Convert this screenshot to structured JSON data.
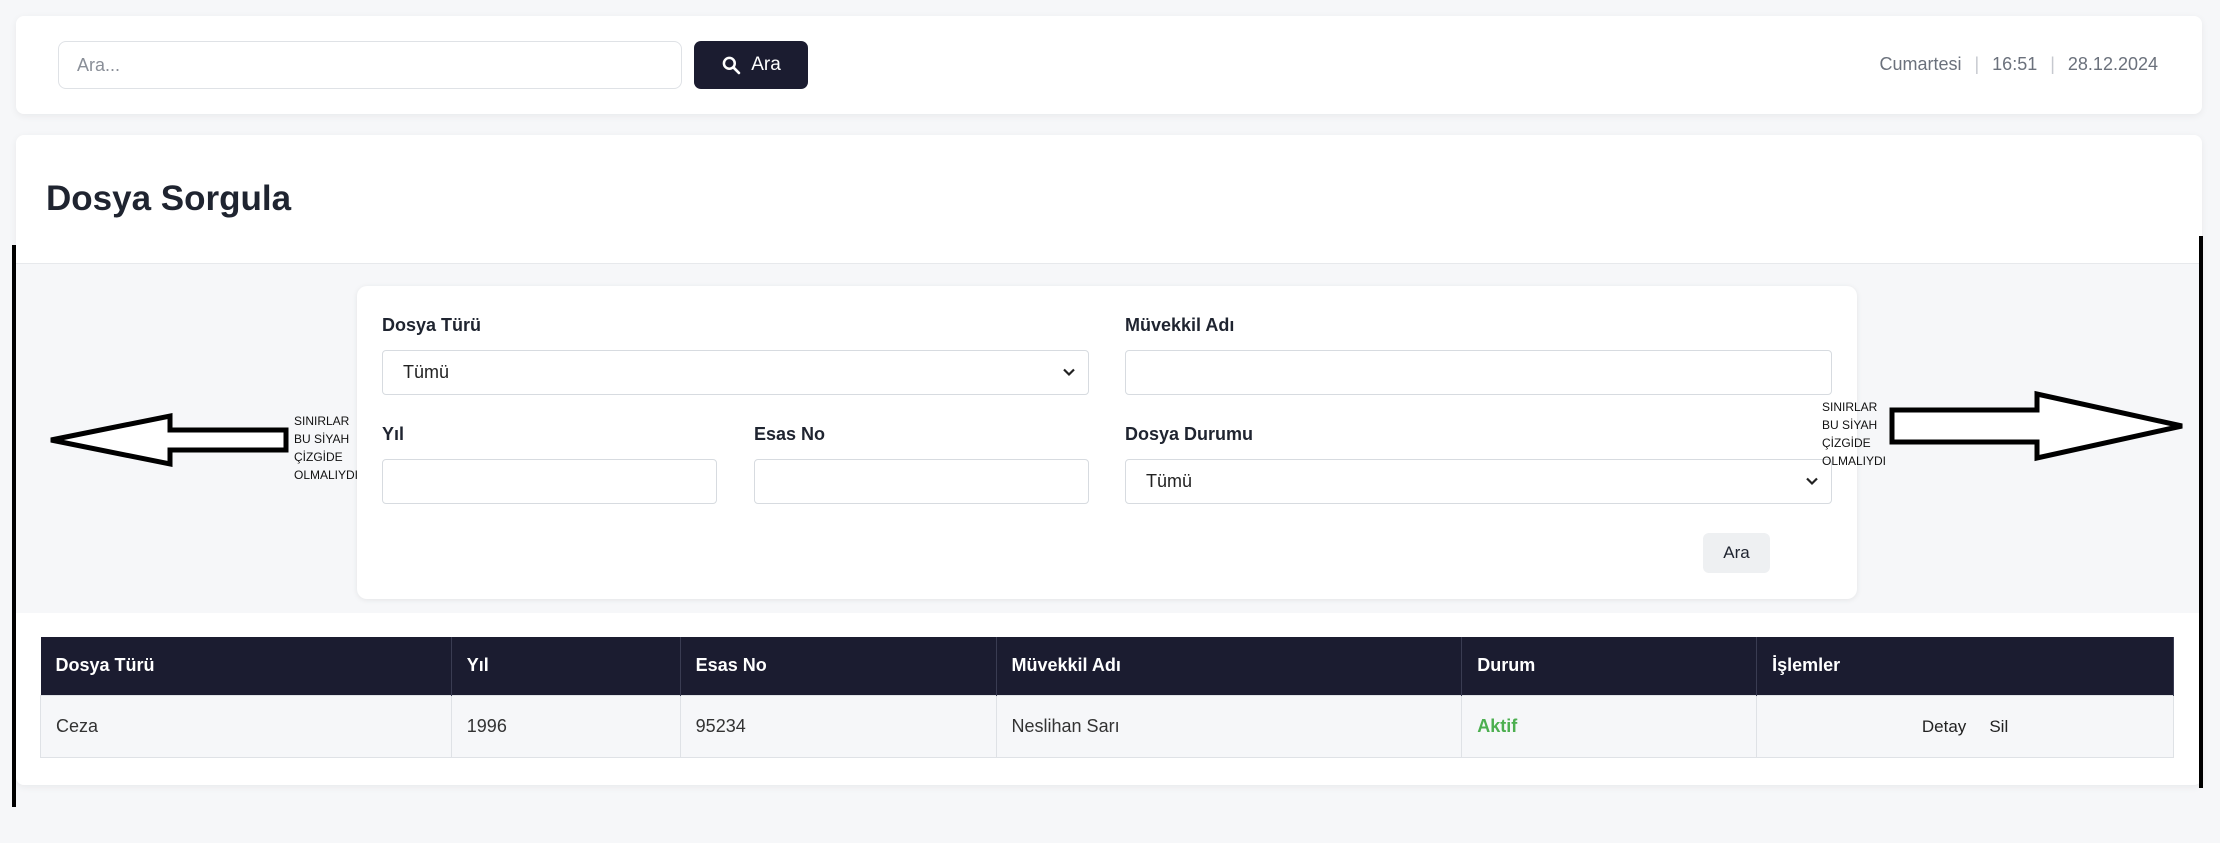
{
  "header": {
    "search": {
      "placeholder": "Ara...",
      "value": ""
    },
    "search_button_label": "Ara",
    "day": "Cumartesi",
    "time": "16:51",
    "date": "28.12.2024"
  },
  "page": {
    "title": "Dosya Sorgula"
  },
  "filters": {
    "dosya_turu": {
      "label": "Dosya Türü",
      "value": "Tümü"
    },
    "muvekkil_adi": {
      "label": "Müvekkil Adı",
      "value": ""
    },
    "yil": {
      "label": "Yıl",
      "value": ""
    },
    "esas_no": {
      "label": "Esas No",
      "value": ""
    },
    "dosya_durumu": {
      "label": "Dosya Durumu",
      "value": "Tümü"
    },
    "submit_label": "Ara"
  },
  "table": {
    "headers": [
      "Dosya Türü",
      "Yıl",
      "Esas No",
      "Müvekkil Adı",
      "Durum",
      "İşlemler"
    ],
    "rows": [
      {
        "dosya_turu": "Ceza",
        "yil": "1996",
        "esas_no": "95234",
        "muvekkil_adi": "Neslihan Sarı",
        "durum": "Aktif",
        "actions": [
          "Detay",
          "Sil"
        ]
      }
    ]
  },
  "annotation": {
    "left_lines": [
      "SINIRLAR",
      "BU SİYAH",
      "ÇİZGİDE",
      "OLMALIYDI"
    ],
    "right_lines": [
      "SINIRLAR",
      "BU SİYAH",
      "ÇİZGİDE",
      "OLMALIYDI"
    ]
  },
  "colors": {
    "accent": "#1b1c30",
    "status_active": "#4caf50",
    "background": "#f6f7f9"
  }
}
